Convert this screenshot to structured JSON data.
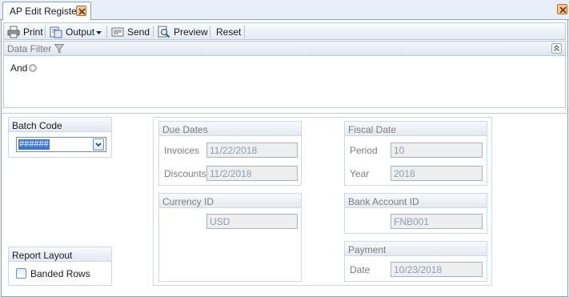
{
  "tab": {
    "title": "AP Edit Register"
  },
  "toolbar": {
    "print_label": "Print",
    "output_label": "Output",
    "send_label": "Send",
    "preview_label": "Preview",
    "reset_label": "Reset"
  },
  "filter": {
    "title": "Data Filter",
    "operator": "And"
  },
  "batch_code": {
    "title": "Batch Code",
    "value": "######"
  },
  "report_layout": {
    "title": "Report Layout",
    "banded_rows_label": "Banded Rows",
    "banded_rows_checked": false
  },
  "due_dates": {
    "title": "Due Dates",
    "invoices_label": "Invoices",
    "invoices_value": "11/22/2018",
    "discounts_label": "Discounts",
    "discounts_value": "11/2/2018"
  },
  "currency": {
    "title": "Currency ID",
    "value": "USD"
  },
  "fiscal_date": {
    "title": "Fiscal Date",
    "period_label": "Period",
    "period_value": "10",
    "year_label": "Year",
    "year_value": "2018"
  },
  "bank_account": {
    "title": "Bank Account ID",
    "value": "FNB001"
  },
  "payment": {
    "title": "Payment",
    "date_label": "Date",
    "date_value": "10/23/2018"
  },
  "icons": {
    "tab_close": "close-icon",
    "window_close": "close-icon",
    "print": "printer-icon",
    "output": "output-icon",
    "output_dropdown": "chevron-down-icon",
    "send": "send-icon",
    "preview": "magnifier-icon",
    "filter": "funnel-icon",
    "add_condition": "plus-circle-icon",
    "collapse": "double-chevron-up-icon",
    "combo_dropdown": "chevron-down-icon"
  },
  "colors": {
    "accent": "#3877d9",
    "border": "#8da2bd",
    "close_button": "#f3c99a",
    "readonly_text": "#8a9fb8"
  }
}
